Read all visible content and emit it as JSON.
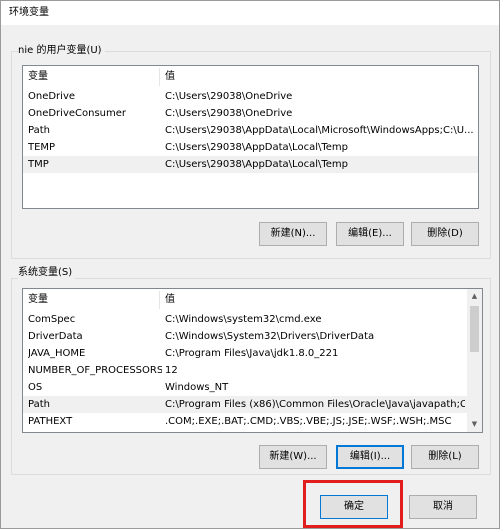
{
  "window": {
    "title": "环境变量"
  },
  "user_vars": {
    "label": "nie 的用户变量(U)",
    "columns": [
      "变量",
      "值"
    ],
    "rows": [
      {
        "name": "OneDrive",
        "value": "C:\\Users\\29038\\OneDrive"
      },
      {
        "name": "OneDriveConsumer",
        "value": "C:\\Users\\29038\\OneDrive"
      },
      {
        "name": "Path",
        "value": "C:\\Users\\29038\\AppData\\Local\\Microsoft\\WindowsApps;C:\\U..."
      },
      {
        "name": "TEMP",
        "value": "C:\\Users\\29038\\AppData\\Local\\Temp"
      },
      {
        "name": "TMP",
        "value": "C:\\Users\\29038\\AppData\\Local\\Temp"
      }
    ],
    "buttons": {
      "new": "新建(N)...",
      "edit": "编辑(E)...",
      "delete": "删除(D)"
    }
  },
  "system_vars": {
    "label": "系统变量(S)",
    "columns": [
      "变量",
      "值"
    ],
    "rows": [
      {
        "name": "ComSpec",
        "value": "C:\\Windows\\system32\\cmd.exe"
      },
      {
        "name": "DriverData",
        "value": "C:\\Windows\\System32\\Drivers\\DriverData"
      },
      {
        "name": "JAVA_HOME",
        "value": "C:\\Program Files\\Java\\jdk1.8.0_221"
      },
      {
        "name": "NUMBER_OF_PROCESSORS",
        "value": "12"
      },
      {
        "name": "OS",
        "value": "Windows_NT"
      },
      {
        "name": "Path",
        "value": "C:\\Program Files (x86)\\Common Files\\Oracle\\Java\\javapath;C:..."
      },
      {
        "name": "PATHEXT",
        "value": ".COM;.EXE;.BAT;.CMD;.VBS;.VBE;.JS;.JSE;.WSF;.WSH;.MSC"
      }
    ],
    "buttons": {
      "new": "新建(W)...",
      "edit": "编辑(I)...",
      "delete": "删除(L)"
    }
  },
  "footer": {
    "ok": "确定",
    "cancel": "取消"
  },
  "colors": {
    "highlight": "#e21d1d",
    "focus": "#0078d7"
  }
}
